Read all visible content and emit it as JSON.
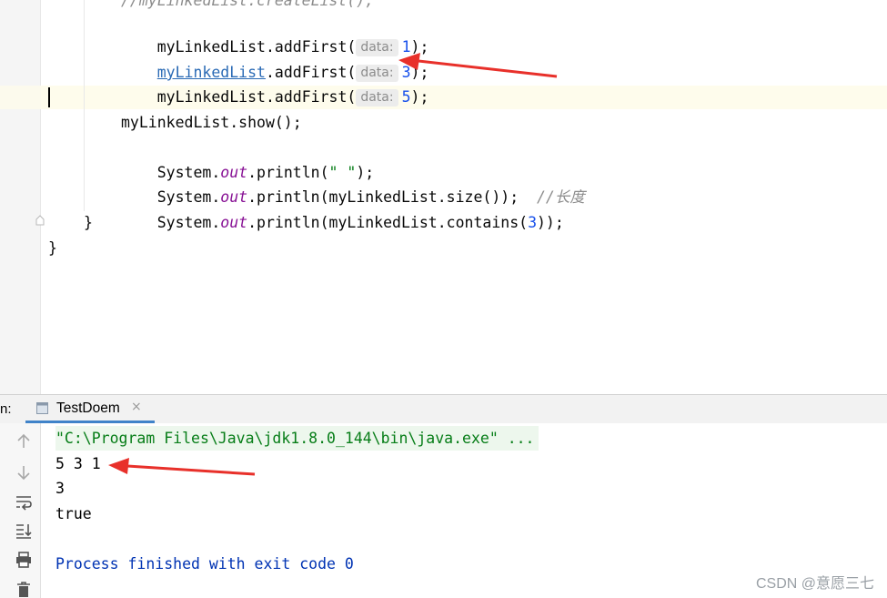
{
  "editor": {
    "lines": {
      "comment_top": "//myLinkedList.createList();",
      "add1": {
        "obj": "myLinkedList",
        "method": ".addFirst(",
        "hint": "data:",
        "value": "1",
        "close": ");"
      },
      "add3": {
        "obj": "myLinkedList",
        "method": ".addFirst(",
        "hint": "data:",
        "value": "3",
        "close": ");"
      },
      "add5": {
        "obj": "myLinkedList",
        "method": ".addFirst(",
        "hint": "data:",
        "value": "5",
        "close": ");"
      },
      "show": "myLinkedList.show();",
      "println1": {
        "pre": "System.",
        "field": "out",
        "mid": ".println(",
        "str": "\" \"",
        "close": ");"
      },
      "println2": {
        "pre": "System.",
        "field": "out",
        "mid": ".println(myLinkedList.size());",
        "comment": "//长度"
      },
      "println3": {
        "pre": "System.",
        "field": "out",
        "mid": ".println(myLinkedList.contains(",
        "num": "3",
        "close": "));"
      },
      "close_method": "}",
      "close_class": "}"
    }
  },
  "run_panel": {
    "label": "n:",
    "tab_label": "TestDoem",
    "tab_close": "×",
    "output": {
      "command": "\"C:\\Program Files\\Java\\jdk1.8.0_144\\bin\\java.exe\" ...",
      "line1": "5 3 1",
      "line2": "3",
      "line3": "true",
      "exit": "Process finished with exit code 0"
    },
    "tools": [
      "up-arrow-icon",
      "down-arrow-icon",
      "soft-wrap-icon",
      "scroll-to-end-icon",
      "print-icon",
      "trash-icon"
    ]
  },
  "watermark": "CSDN @意愿三七",
  "colors": {
    "annotation_arrow": "#e8302a",
    "tab_underline": "#4083c9"
  }
}
